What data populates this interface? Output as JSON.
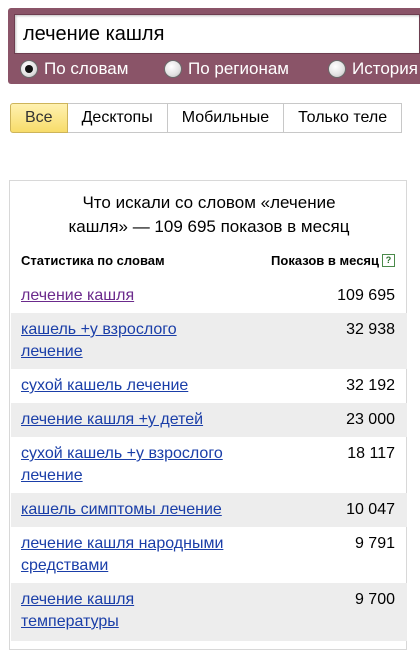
{
  "search": {
    "query": "лечение кашля"
  },
  "search_mode": {
    "options": [
      {
        "label": "По словам",
        "checked": true
      },
      {
        "label": "По регионам",
        "checked": false
      },
      {
        "label": "История",
        "checked": false
      }
    ]
  },
  "tabs": [
    {
      "label": "Все",
      "active": true
    },
    {
      "label": "Десктопы",
      "active": false
    },
    {
      "label": "Мобильные",
      "active": false
    },
    {
      "label": "Только теле",
      "active": false
    }
  ],
  "results": {
    "title": "Что искали со словом «лечение кашля» — 109 695 показов в месяц",
    "col_phrase": "Статистика по словам",
    "col_count": "Показов в месяц",
    "help_glyph": "?",
    "rows": [
      {
        "phrase": "лечение кашля",
        "count": "109 695"
      },
      {
        "phrase": "кашель +у взрослого лечение",
        "count": "32 938"
      },
      {
        "phrase": "сухой кашель лечение",
        "count": "32 192"
      },
      {
        "phrase": "лечение кашля +у детей",
        "count": "23 000"
      },
      {
        "phrase": "сухой кашель +у взрослого лечение",
        "count": "18 117"
      },
      {
        "phrase": "кашель симптомы лечение",
        "count": "10 047"
      },
      {
        "phrase": "лечение кашля народными средствами",
        "count": "9 791"
      },
      {
        "phrase": "лечение кашля температуры",
        "count": "9 700"
      }
    ]
  },
  "colors": {
    "header_bg": "#8a5468",
    "link": "#1a3ea8",
    "visited_link": "#6b2a8c",
    "active_tab": "#f7dc6a",
    "row_shade": "#ededed"
  }
}
